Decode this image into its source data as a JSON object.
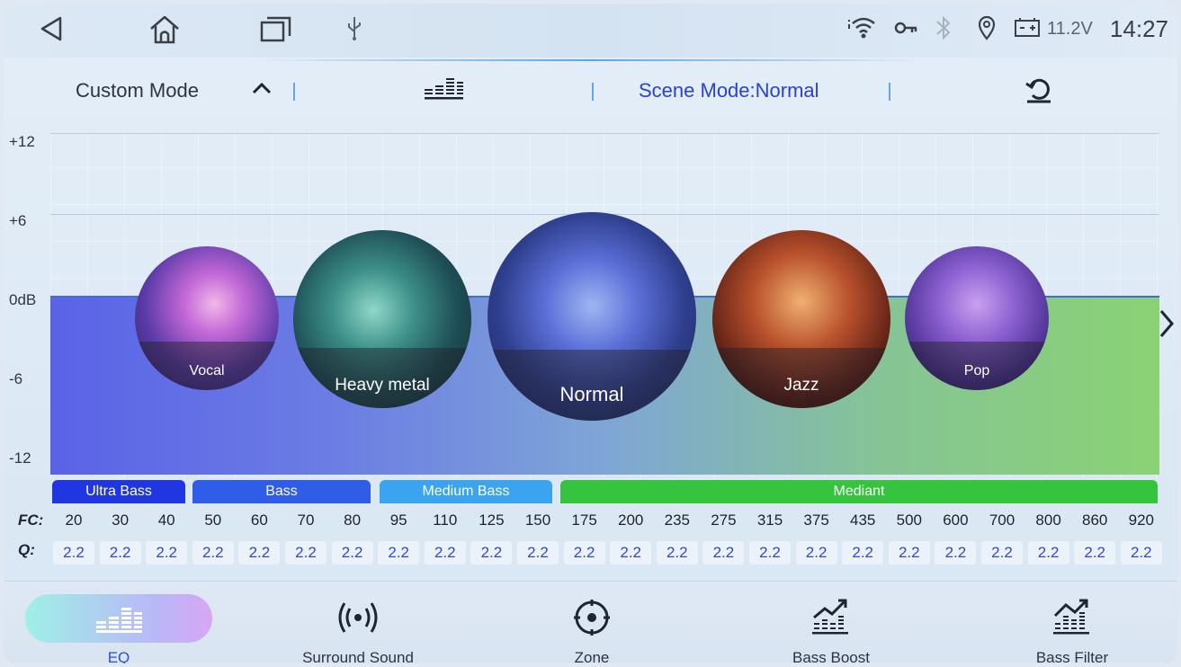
{
  "status": {
    "voltage": "11.2V",
    "time": "14:27"
  },
  "mode_bar": {
    "custom_mode": "Custom Mode",
    "scene_mode": "Scene Mode:Normal"
  },
  "chart": {
    "y_labels": [
      "+12",
      "+6",
      "0dB",
      "-6",
      "-12"
    ]
  },
  "scenes": [
    {
      "name": "Vocal"
    },
    {
      "name": "Heavy metal"
    },
    {
      "name": "Normal"
    },
    {
      "name": "Jazz"
    },
    {
      "name": "Pop"
    }
  ],
  "bands": [
    {
      "name": "Ultra Bass",
      "color": "#1f36e0"
    },
    {
      "name": "Bass",
      "color": "#2f5de8"
    },
    {
      "name": "Medium Bass",
      "color": "#3aa4f0"
    },
    {
      "name": "Mediant",
      "color": "#36c43f"
    }
  ],
  "rows": {
    "fc_label": "FC:",
    "q_label": "Q:",
    "fc": [
      "20",
      "30",
      "40",
      "50",
      "60",
      "70",
      "80",
      "95",
      "110",
      "125",
      "150",
      "175",
      "200",
      "235",
      "275",
      "315",
      "375",
      "435",
      "500",
      "600",
      "700",
      "800",
      "860",
      "920"
    ],
    "q": [
      "2.2",
      "2.2",
      "2.2",
      "2.2",
      "2.2",
      "2.2",
      "2.2",
      "2.2",
      "2.2",
      "2.2",
      "2.2",
      "2.2",
      "2.2",
      "2.2",
      "2.2",
      "2.2",
      "2.2",
      "2.2",
      "2.2",
      "2.2",
      "2.2",
      "2.2",
      "2.2",
      "2.2"
    ]
  },
  "nav": {
    "eq": "EQ",
    "surround": "Surround Sound",
    "zone": "Zone",
    "bass_boost": "Bass Boost",
    "bass_filter": "Bass Filter"
  }
}
